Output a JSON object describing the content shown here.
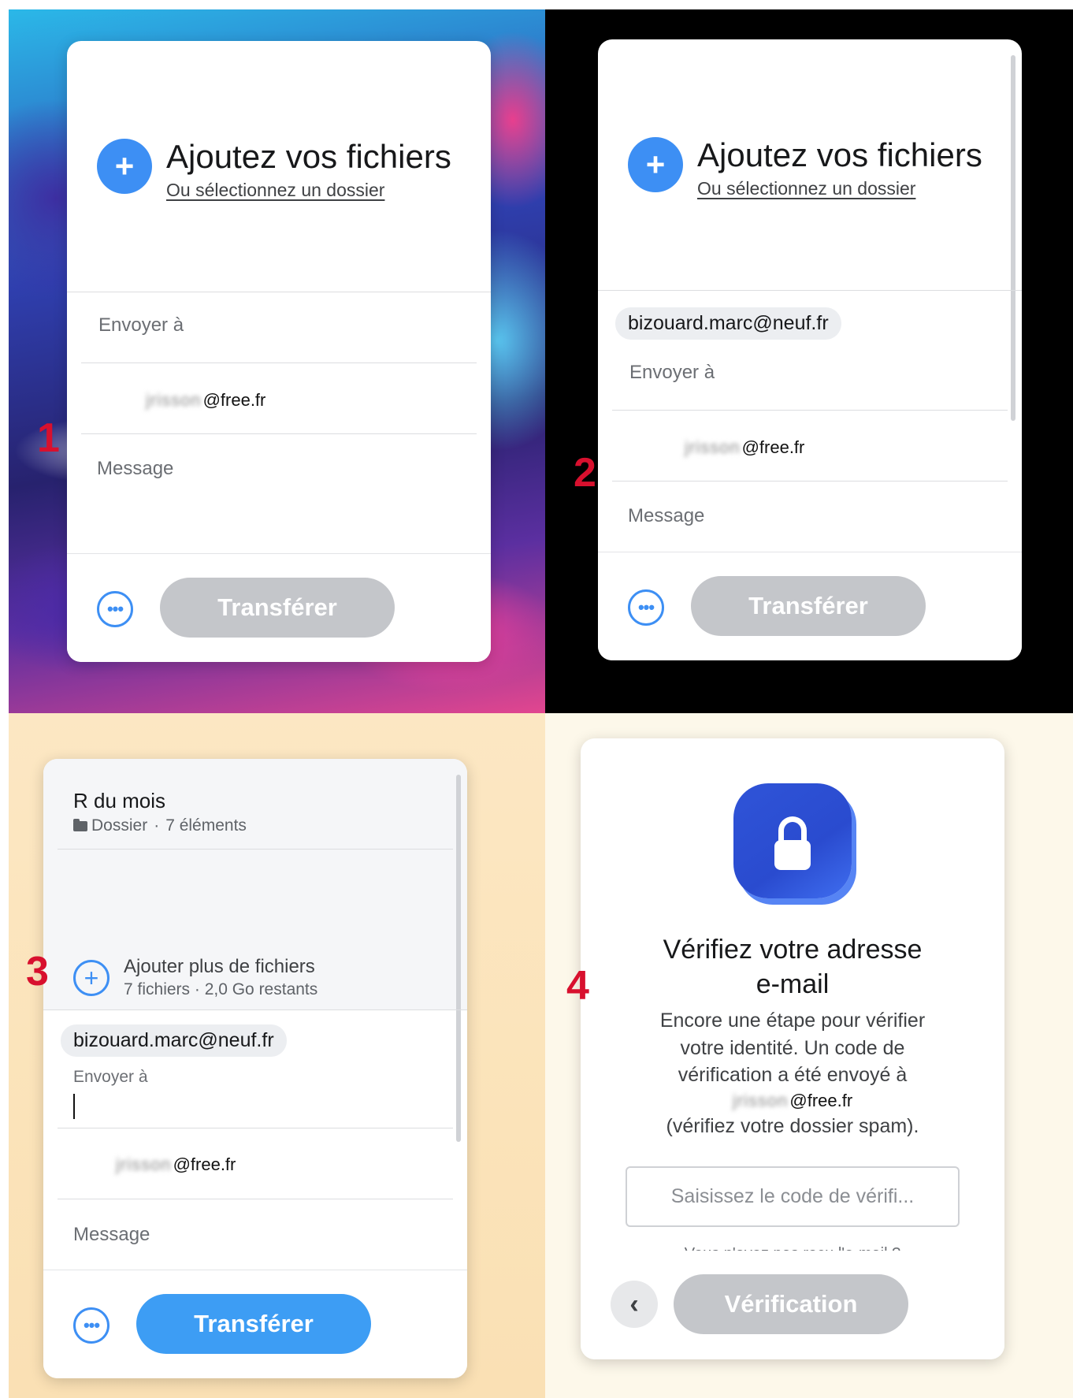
{
  "step_labels": [
    "1",
    "2",
    "3",
    "4"
  ],
  "upload": {
    "title": "Ajoutez vos fichiers",
    "select_folder": "Ou sélectionnez un dossier"
  },
  "recipient_chip": "bizouard.marc@neuf.fr",
  "send_to_placeholder": "Envoyer à",
  "suggestion": {
    "name_blurred": "jrisson",
    "domain": "@free.fr"
  },
  "message_placeholder": "Message",
  "transfer_label": "Transférer",
  "more_options_icon": "ellipsis-icon",
  "folder": {
    "name": "R du mois",
    "type_label": "Dossier",
    "separator": "·",
    "count_label": "7 éléments"
  },
  "add_more": {
    "title": "Ajouter plus de fichiers",
    "subtitle": "7 fichiers · 2,0 Go restants"
  },
  "verify": {
    "title_line1": "Vérifiez votre adresse",
    "title_line2": "e-mail",
    "body_line1": "Encore une étape pour vérifier",
    "body_line2": "votre identité. Un code de",
    "body_line3": "vérification a été envoyé à",
    "body_line5": "(vérifiez votre dossier spam).",
    "code_placeholder": "Saisissez le code de vérifi...",
    "resend_text": "Vous n'avez pas reçu l'e-mail ?",
    "button_label": "Vérification",
    "back_icon": "chevron-left-icon",
    "lock_icon": "lock-icon"
  },
  "colors": {
    "accent": "#3d8ff4",
    "disabled": "#c4c6ca",
    "step_number": "#d8102e",
    "lock_badge": "#2f54d8"
  }
}
